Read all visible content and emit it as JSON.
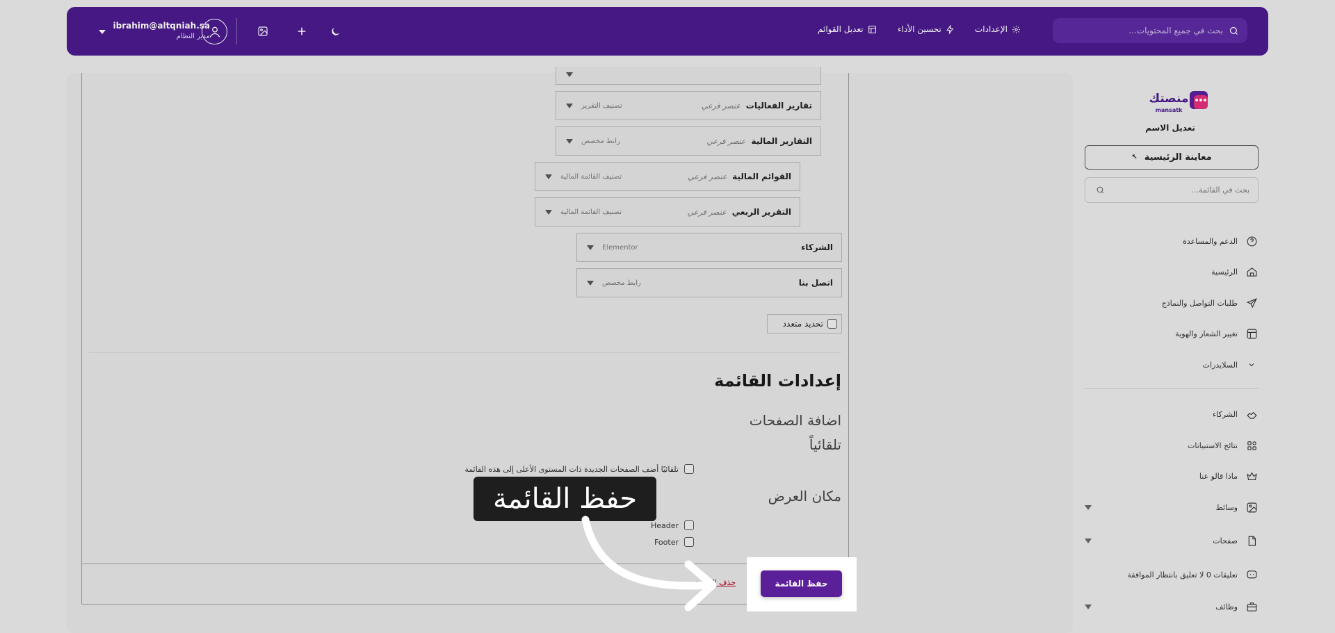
{
  "header": {
    "search_placeholder": "بحث في جميع المحتويات...",
    "nav": {
      "settings": "الإعدادات",
      "performance": "تحسين الأداء",
      "edit_menus": "تعديل القوائم"
    },
    "user": {
      "email": "ibrahim@altqniah.sa",
      "role": "مدير النظام"
    }
  },
  "sidebar": {
    "logo_text": "منصتك",
    "logo_sub": "mansatk",
    "site_name": "تعديل الاسم",
    "preview_label": "معاينة الرئيسية",
    "search_placeholder": "بحث في القائمة...",
    "items": [
      {
        "label": "الدعم والمساعدة",
        "icon": "help-icon"
      },
      {
        "label": "الرئيسية",
        "icon": "home-icon"
      },
      {
        "label": "طلبات التواصل والنماذج",
        "icon": "send-icon"
      },
      {
        "label": "تغيير الشعار والهوية",
        "icon": "layout-icon"
      },
      {
        "label": "السلايدرات",
        "icon": "chevron-down-icon"
      },
      {
        "label": "الشركاء",
        "icon": "handshake-icon"
      },
      {
        "label": "نتائج الاستبيانات",
        "icon": "grid-icon"
      },
      {
        "label": "ماذا قالو عنا",
        "icon": "crown-icon"
      },
      {
        "label": "وسائط",
        "icon": "image-icon"
      },
      {
        "label": "صفحات",
        "icon": "page-icon"
      },
      {
        "label": "تعليقات 0 لا تعليق بانتظار الموافقة",
        "icon": "comment-icon"
      },
      {
        "label": "وظائف",
        "icon": "briefcase-icon"
      }
    ]
  },
  "menu_items": [
    {
      "title": "تقارير الفعاليات",
      "type": "عنصر فرعي",
      "category": "تصنيف التقرير"
    },
    {
      "title": "التقارير المالية",
      "type": "عنصر فرعي",
      "category": "رابط مخصص"
    },
    {
      "title": "القوائم المالية",
      "type": "عنصر فرعي",
      "category": "تصنيف القائمة المالية"
    },
    {
      "title": "التقرير الربعي",
      "type": "عنصر فرعي",
      "category": "تصنيف القائمة المالية"
    },
    {
      "title": "الشركاء",
      "type": "",
      "category": "Elementor"
    },
    {
      "title": "اتصل بنا",
      "type": "",
      "category": "رابط مخصص"
    }
  ],
  "bulk_select_label": "تحديد متعدد",
  "settings": {
    "title": "إعدادات القائمة",
    "add_pages_line1": "اضافة الصفحات",
    "add_pages_line2": "تلقائياً",
    "auto_add_label": "تلقائيًا أضف الصفحات الجديدة ذات المستوى الأعلى إلى هذه القائمة",
    "display_location_title": "مكان العرض",
    "locations": [
      "Header",
      "Footer"
    ]
  },
  "actions": {
    "save_label": "حفظ القائمة",
    "delete_label": "حذف القائمة"
  },
  "tooltip": {
    "text": "حفظ القائمة"
  },
  "colors": {
    "brand_purple": "#4a1a8c",
    "button_purple": "#5b1f9a",
    "delete_red": "#b00020"
  }
}
